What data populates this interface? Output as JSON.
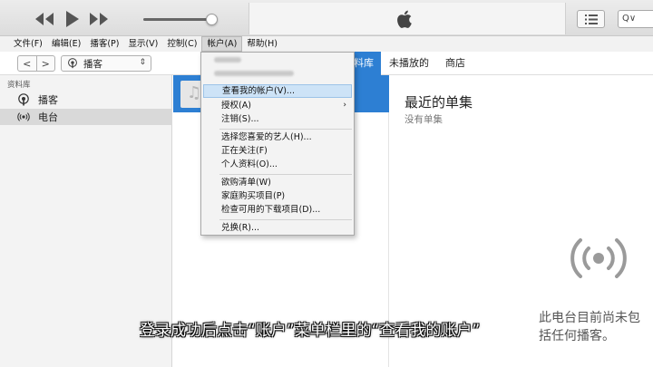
{
  "menubar": {
    "items": [
      "文件(F)",
      "编辑(E)",
      "播客(P)",
      "显示(V)",
      "控制(C)",
      "帐户(A)",
      "帮助(H)"
    ],
    "active_index": 5
  },
  "toolbar": {
    "back": "<",
    "forward": ">",
    "media_select": "播客",
    "tabs": [
      "资料库",
      "未播放的",
      "商店"
    ],
    "tab_visible_partial": "料库",
    "selected_tab_index": 0
  },
  "search": {
    "placeholder": "Q∨"
  },
  "sidebar": {
    "heading": "资料库",
    "items": [
      {
        "label": "播客",
        "icon": "podcast-icon"
      },
      {
        "label": "电台",
        "icon": "radio-icon"
      }
    ],
    "selected_index": 1
  },
  "account_menu": {
    "items": [
      {
        "label": "查看我的帐户(V)...",
        "highlighted": true
      },
      {
        "label": "授权(A)",
        "submenu": true
      },
      {
        "label": "注销(S)..."
      },
      {
        "label": "选择您喜爱的艺人(H)..."
      },
      {
        "label": "正在关注(F)"
      },
      {
        "label": "个人资料(O)..."
      },
      {
        "label": "欲购清单(W)"
      },
      {
        "label": "家庭购买项目(P)"
      },
      {
        "label": "检查可用的下载项目(D)..."
      },
      {
        "label": "兑换(R)..."
      }
    ]
  },
  "detail": {
    "title": "最近的单集",
    "subtitle": "没有单集",
    "empty_line1": "此电台目前尚未包",
    "empty_line2": "括任何播客。"
  },
  "caption": "登录成功后点击“账户”菜单栏里的“查看我的账户”",
  "colors": {
    "accent": "#2d7fd3",
    "highlight": "#cde3f7"
  }
}
